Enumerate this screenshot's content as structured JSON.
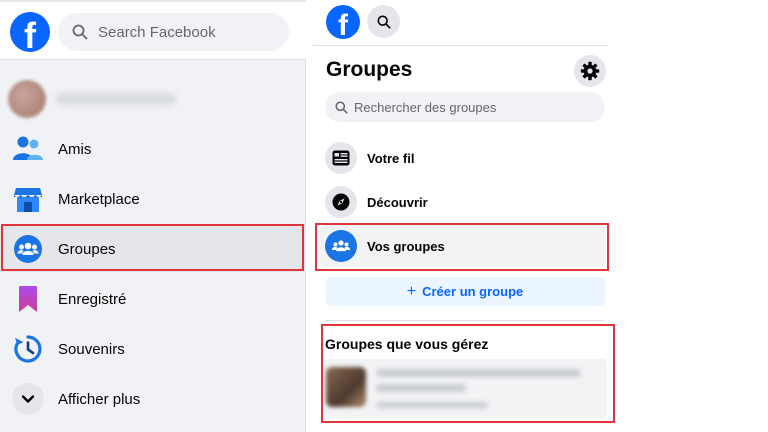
{
  "left": {
    "search_placeholder": "Search Facebook",
    "nav": [
      {
        "label": "Amis",
        "icon": "friends-icon"
      },
      {
        "label": "Marketplace",
        "icon": "marketplace-icon"
      },
      {
        "label": "Groupes",
        "icon": "groups-icon"
      },
      {
        "label": "Enregistré",
        "icon": "bookmark-icon"
      },
      {
        "label": "Souvenirs",
        "icon": "memories-icon"
      },
      {
        "label": "Afficher plus",
        "icon": "chevron-down-icon"
      }
    ]
  },
  "mid": {
    "title": "Groupes",
    "search_placeholder": "Rechercher des groupes",
    "items": [
      {
        "label": "Votre fil",
        "icon": "feed-icon"
      },
      {
        "label": "Découvrir",
        "icon": "compass-icon"
      },
      {
        "label": "Vos groupes",
        "icon": "groups-icon"
      }
    ],
    "create_label": "Créer un groupe",
    "managed_title": "Groupes que vous gérez"
  },
  "colors": {
    "brand_blue": "#0866ff",
    "highlight_red": "#e0353b",
    "sidebar_bg": "#f0f2f5"
  }
}
